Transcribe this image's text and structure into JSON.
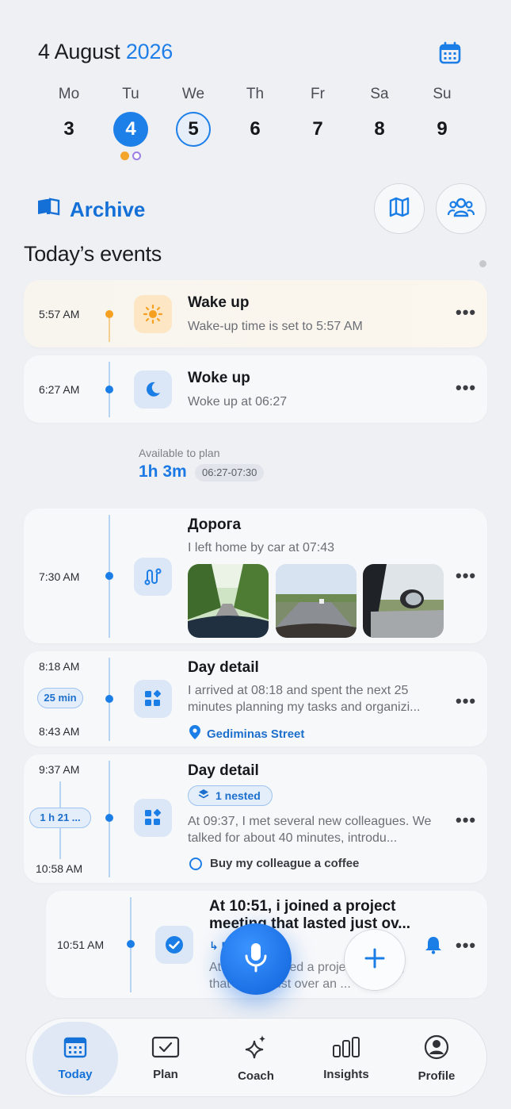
{
  "header": {
    "date_prefix": "4 August",
    "year": "2026",
    "calendar_icon": "calendar-icon"
  },
  "week": [
    {
      "name": "Mo",
      "num": "3"
    },
    {
      "name": "Tu",
      "num": "4"
    },
    {
      "name": "We",
      "num": "5"
    },
    {
      "name": "Th",
      "num": "6"
    },
    {
      "name": "Fr",
      "num": "7"
    },
    {
      "name": "Sa",
      "num": "8"
    },
    {
      "name": "Su",
      "num": "9"
    }
  ],
  "archive": {
    "label": "Archive"
  },
  "section_title": "Today’s events",
  "events": {
    "wake": {
      "time": "5:57 AM",
      "title": "Wake up",
      "sub": "Wake-up time is set to 5:57 AM"
    },
    "woke": {
      "time": "6:27 AM",
      "title": "Woke up",
      "sub": "Woke up at 06:27"
    },
    "available": {
      "label": "Available to plan",
      "value": "1h 3m",
      "range": "06:27-07:30"
    },
    "road": {
      "time": "7:30 AM",
      "title": "Дорога",
      "sub": "I left home by car at 07:43"
    },
    "detail1": {
      "start": "8:18 AM",
      "duration": "25 min",
      "end": "8:43 AM",
      "title": "Day detail",
      "sub": "I arrived at 08:18 and spent the next 25 minutes planning my tasks and organizi...",
      "location": "Gediminas Street"
    },
    "detail2": {
      "start": "9:37 AM",
      "duration": "1 h 21 ...",
      "end": "10:58 AM",
      "title": "Day detail",
      "nested": "1 nested",
      "sub": "At 09:37, I met several new colleagues. We talked for about 40 minutes, introdu...",
      "todo": "Buy my colleague a coffee"
    },
    "project": {
      "time": "10:51 AM",
      "title": "At 10:51, i joined a project meeting that lasted just ov...",
      "parent": "↳ Day detail",
      "sub": "At 10:51, i joined a project meeting that lasted just over an ..."
    }
  },
  "nav": [
    {
      "label": "Today"
    },
    {
      "label": "Plan"
    },
    {
      "label": "Coach"
    },
    {
      "label": "Insights"
    },
    {
      "label": "Profile"
    }
  ],
  "colors": {
    "accent": "#1d7fe8",
    "wake": "#f5a020",
    "background": "#eef0f4"
  }
}
